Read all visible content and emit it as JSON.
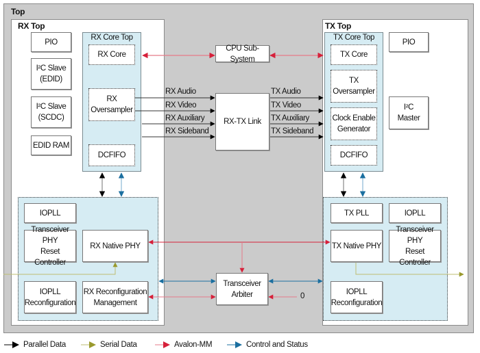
{
  "diagram": {
    "top_label": "Top",
    "rx_top": {
      "label": "RX Top",
      "pio": "PIO",
      "i2c_slave_edid": {
        "line1": "I²C Slave",
        "line2": "(EDID)"
      },
      "i2c_slave_scdc": {
        "line1": "I²C Slave",
        "line2": "(SCDC)"
      },
      "edid_ram": "EDID RAM",
      "core_top": {
        "label": "RX Core Top",
        "core": "RX Core",
        "oversampler": {
          "line1": "RX",
          "line2": "Oversampler"
        },
        "dcfifo": "DCFIFO"
      },
      "phy_group": {
        "iopll": "IOPLL",
        "reset_controller": {
          "line1": "Transceiver PHY",
          "line2": "Reset Controller"
        },
        "native_phy": "RX Native PHY",
        "iopll_reconfig": {
          "line1": "IOPLL",
          "line2": "Reconfiguration"
        },
        "reconfig_mgmt": {
          "line1": "RX Reconfiguration",
          "line2": "Management"
        }
      }
    },
    "center": {
      "cpu": "CPU Sub-System",
      "link": "RX-TX Link",
      "arbiter": {
        "line1": "Transceiver",
        "line2": "Arbiter"
      },
      "arbiter_input": "0",
      "rx_signals": [
        "RX Audio",
        "RX Video",
        "RX Auxiliary",
        "RX Sideband"
      ],
      "tx_signals": [
        "TX Audio",
        "TX Video",
        "TX Auxiliary",
        "TX Sideband"
      ]
    },
    "tx_top": {
      "label": "TX Top",
      "pio": "PIO",
      "i2c_master": {
        "line1": "I²C",
        "line2": "Master"
      },
      "core_top": {
        "label": "TX Core Top",
        "core": "TX Core",
        "oversampler": {
          "line1": "TX",
          "line2": "Oversampler"
        },
        "clock_enable": {
          "line1": "Clock Enable",
          "line2": "Generator"
        },
        "dcfifo": "DCFIFO"
      },
      "phy_group": {
        "tx_pll": "TX PLL",
        "iopll": "IOPLL",
        "native_phy": "TX Native PHY",
        "reset_controller": {
          "line1": "Transceiver PHY",
          "line2": "Reset Controller"
        },
        "iopll_reconfig": {
          "line1": "IOPLL",
          "line2": "Reconfiguration"
        }
      }
    }
  },
  "legend": [
    {
      "label": "Parallel Data",
      "color": "#000000"
    },
    {
      "label": "Serial Data",
      "color": "#9a9a2e"
    },
    {
      "label": "Avalon-MM",
      "color": "#d6203a"
    },
    {
      "label": "Control and Status",
      "color": "#1b6fa0"
    }
  ],
  "colors": {
    "top_bg": "#cbcbcb",
    "core_bg": "#d6ecf3",
    "parallel": "#000000",
    "serial": "#9a9a2e",
    "avalon": "#d6203a",
    "control": "#1b6fa0"
  }
}
